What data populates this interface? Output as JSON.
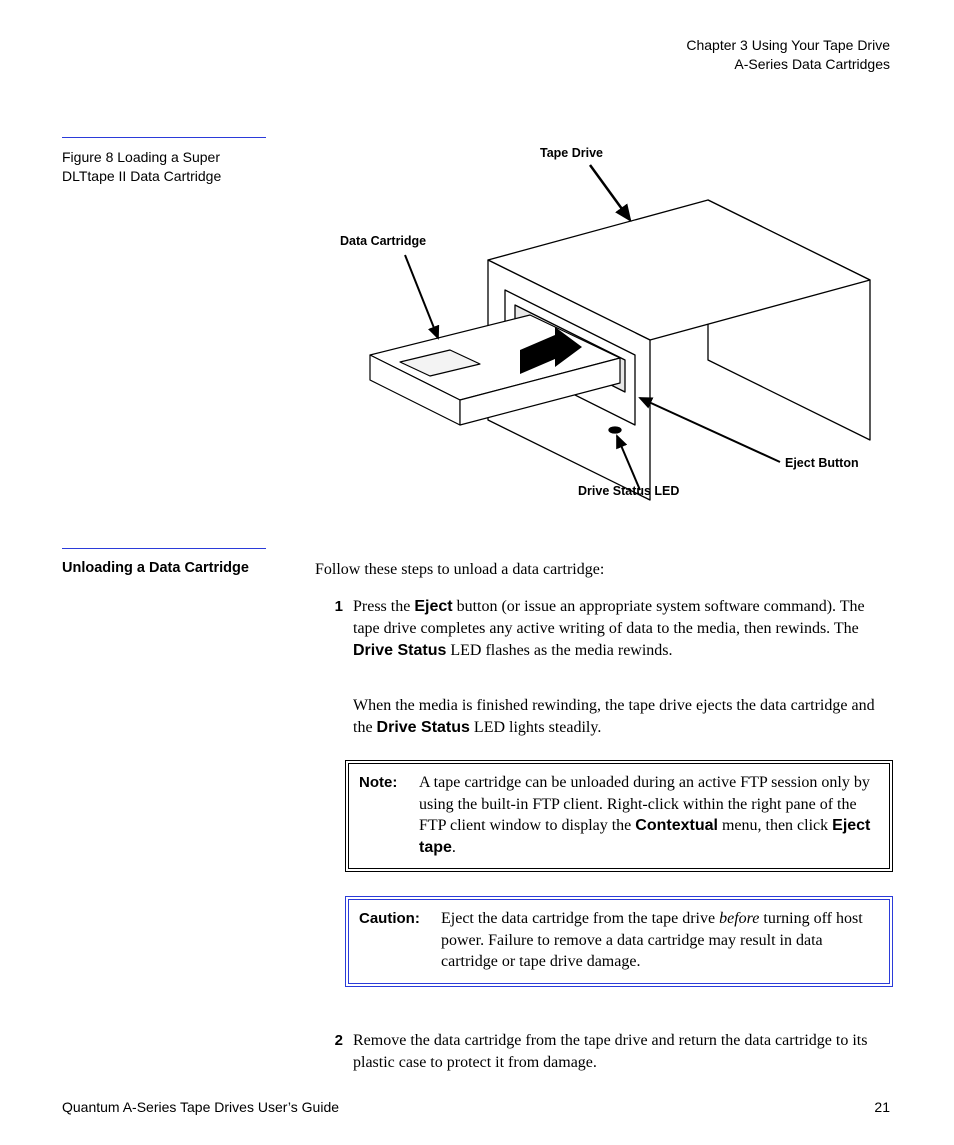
{
  "header": {
    "chapter_line": "Chapter 3  Using Your Tape Drive",
    "section_line": "A-Series Data Cartridges"
  },
  "figure": {
    "caption": "Figure 8  Loading a Super DLTtape II Data Cartridge",
    "callouts": {
      "tape_drive": "Tape Drive",
      "data_cartridge": "Data Cartridge",
      "drive_status_led": "Drive Status LED",
      "eject_button": "Eject Button"
    }
  },
  "sidebar_heading": "Unloading a Data Cartridge",
  "intro": "Follow these steps to unload a data cartridge:",
  "step1": {
    "num": "1",
    "pre": "Press the ",
    "eject": "Eject",
    "mid": " button (or issue an appropriate system software command). The tape drive completes any active writing of data to the media, then rewinds. The ",
    "drive_status": "Drive Status",
    "post": " LED flashes as the media rewinds."
  },
  "followup": {
    "pre": "When the media is finished rewinding, the tape drive ejects the data cartridge and the ",
    "drive_status": "Drive Status",
    "post": " LED lights steadily."
  },
  "note": {
    "label": "Note:",
    "pre": "A tape cartridge can be unloaded during an active FTP session only by using the built-in FTP client. Right-click within the right pane of the FTP client window to display the ",
    "contextual": "Contextual",
    "mid": " menu, then click ",
    "eject_tape": "Eject tape",
    "post": "."
  },
  "caution": {
    "label": "Caution:",
    "pre": "Eject the data cartridge from the tape drive ",
    "before": "before",
    "post": " turning off host power. Failure to remove a data cartridge may result in data cartridge or tape drive damage."
  },
  "step2": {
    "num": "2",
    "text": "Remove the data cartridge from the tape drive and return the data cartridge to its plastic case to protect it from damage."
  },
  "footer": {
    "left": "Quantum A-Series Tape Drives User’s Guide",
    "page": "21"
  }
}
